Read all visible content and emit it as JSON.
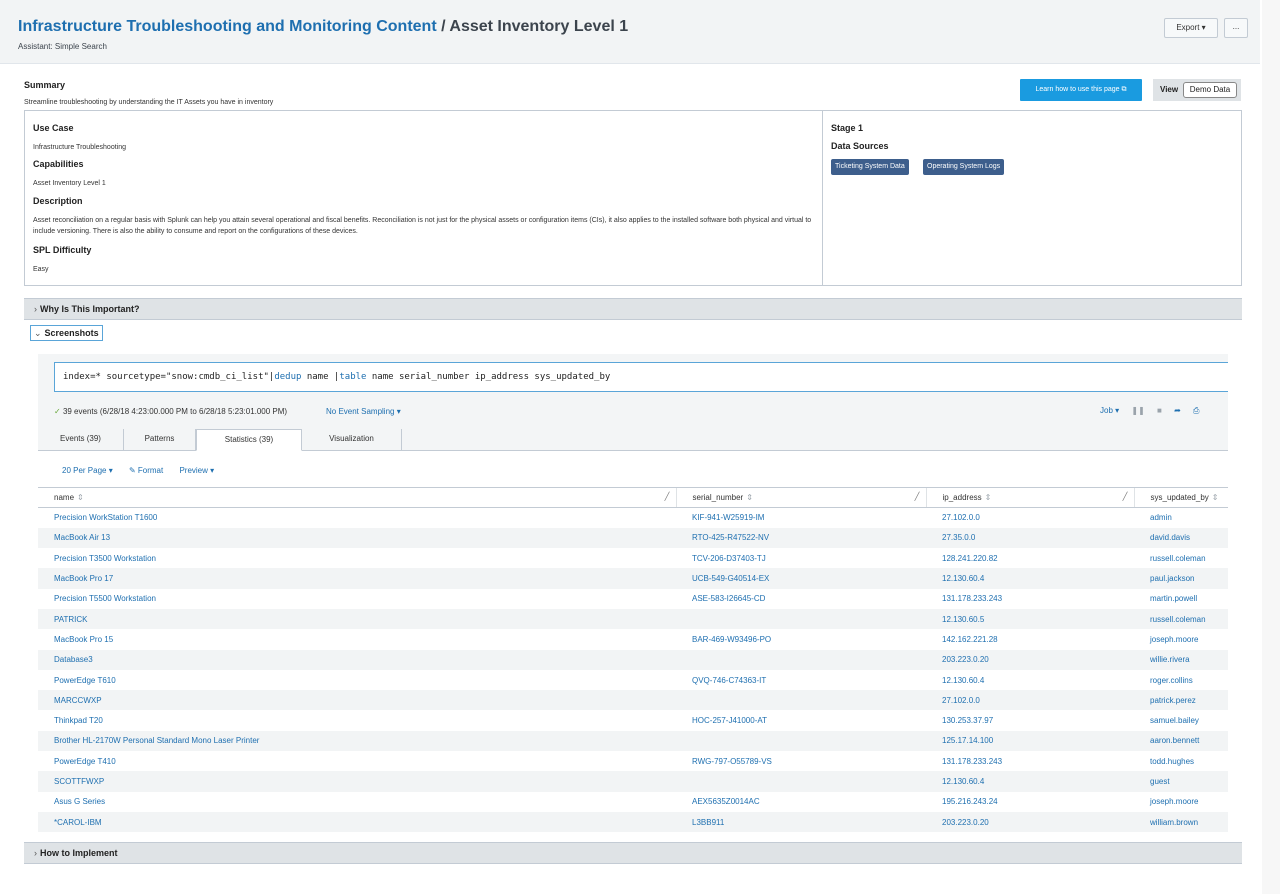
{
  "header": {
    "app_title": "Infrastructure Troubleshooting and Monitoring Content",
    "separator": " / ",
    "page_title": "Asset Inventory Level 1",
    "subtitle": "Assistant: Simple Search",
    "export_label": "Export ▾",
    "more_label": "..."
  },
  "summary": {
    "heading": "Summary",
    "text": "Streamline troubleshooting by understanding the IT Assets you have in inventory",
    "learn_button": "Learn how to use this page ⧉",
    "view_label": "View",
    "view_value": "Demo Data",
    "use_case_label": "Use Case",
    "use_case": "Infrastructure Troubleshooting",
    "capabilities_label": "Capabilities",
    "capabilities": "Asset Inventory Level 1",
    "description_label": "Description",
    "description": "Asset reconciliation on a regular basis with Splunk can help you attain several operational and fiscal benefits. Reconciliation is not just for the physical assets or configuration items (CIs), it also applies to the installed software both physical and virtual to include versioning. There is also the ability to consume and report on the configurations of these devices.",
    "spl_label": "SPL Difficulty",
    "spl": "Easy",
    "stage": "Stage 1",
    "data_sources_label": "Data Sources",
    "data_sources": [
      "Ticketing System Data",
      "Operating System Logs"
    ]
  },
  "sections": {
    "why": "Why Is This Important?",
    "screenshots": "Screenshots",
    "implement": "How to Implement"
  },
  "search": {
    "query_prefix": "index=* sourcetype=\"snow:cmdb_ci_list\"|",
    "cmd1": "dedup",
    "query_mid": " name |",
    "cmd2": "table",
    "query_suffix": " name serial_number ip_address sys_updated_by",
    "events_text": "39 events (6/28/18 4:23:00.000 PM to 6/28/18 5:23:01.000 PM)",
    "sampling": "No Event Sampling ▾",
    "job_label": "Job ▾"
  },
  "tabs": [
    "Events (39)",
    "Patterns",
    "Statistics (39)",
    "Visualization"
  ],
  "options": {
    "per_page": "20 Per Page ▾",
    "format": "✎ Format",
    "preview": "Preview ▾"
  },
  "table": {
    "columns": [
      "name",
      "serial_number",
      "ip_address",
      "sys_updated_by"
    ],
    "rows": [
      [
        "Precision WorkStation T1600",
        "KIF-941-W25919-IM",
        "27.102.0.0",
        "admin"
      ],
      [
        "MacBook Air 13",
        "RTO-425-R47522-NV",
        "27.35.0.0",
        "david.davis"
      ],
      [
        "Precision T3500 Workstation",
        "TCV-206-D37403-TJ",
        "128.241.220.82",
        "russell.coleman"
      ],
      [
        "MacBook Pro 17",
        "UCB-549-G40514-EX",
        "12.130.60.4",
        "paul.jackson"
      ],
      [
        "Precision T5500 Workstation",
        "ASE-583-I26645-CD",
        "131.178.233.243",
        "martin.powell"
      ],
      [
        "PATRICK",
        "",
        "12.130.60.5",
        "russell.coleman"
      ],
      [
        "MacBook Pro 15",
        "BAR-469-W93496-PO",
        "142.162.221.28",
        "joseph.moore"
      ],
      [
        "Database3",
        "",
        "203.223.0.20",
        "willie.rivera"
      ],
      [
        "PowerEdge T610",
        "QVQ-746-C74363-IT",
        "12.130.60.4",
        "roger.collins"
      ],
      [
        "MARCCWXP",
        "",
        "27.102.0.0",
        "patrick.perez"
      ],
      [
        "Thinkpad T20",
        "HOC-257-J41000-AT",
        "130.253.37.97",
        "samuel.bailey"
      ],
      [
        "Brother HL-2170W Personal Standard Mono Laser Printer",
        "",
        "125.17.14.100",
        "aaron.bennett"
      ],
      [
        "PowerEdge T410",
        "RWG-797-O55789-VS",
        "131.178.233.243",
        "todd.hughes"
      ],
      [
        "SCOTTFWXP",
        "",
        "12.130.60.4",
        "guest"
      ],
      [
        "Asus G Series",
        "AEX5635Z0014AC",
        "195.216.243.24",
        "joseph.moore"
      ],
      [
        "*CAROL-IBM",
        "L3BB911",
        "203.223.0.20",
        "william.brown"
      ]
    ]
  }
}
